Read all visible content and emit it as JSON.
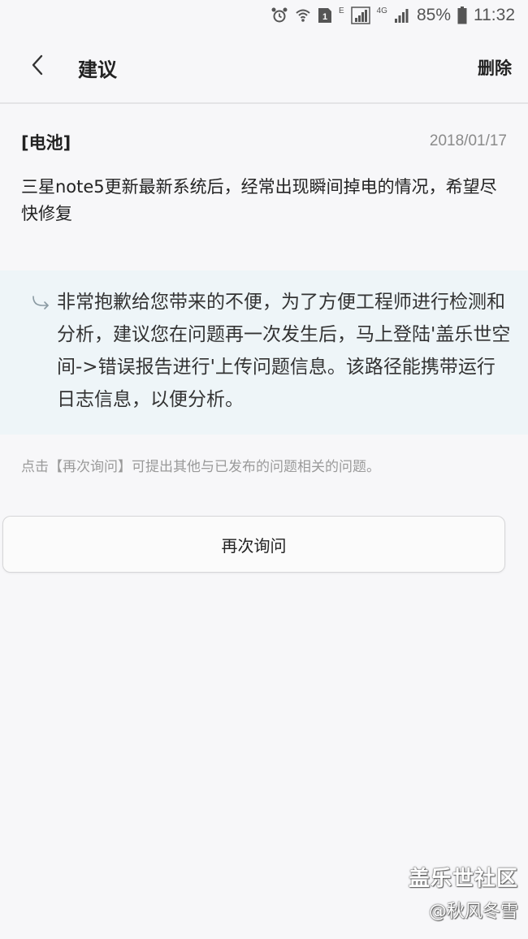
{
  "status_bar": {
    "signal_e": "E",
    "network_4g": "4G",
    "battery_percent": "85%",
    "time": "11:32",
    "icons": [
      "alarm-icon",
      "wifi-icon",
      "sim-icon",
      "signal-icon",
      "battery-icon"
    ]
  },
  "header": {
    "title": "建议",
    "delete_label": "删除",
    "back_icon": "chevron-left-icon"
  },
  "question": {
    "category": "[电池]",
    "date": "2018/01/17",
    "text": "三星note5更新最新系统后，经常出现瞬间掉电的情况，希望尽快修复"
  },
  "answer": {
    "icon": "reply-arrow-icon",
    "text": "非常抱歉给您带来的不便，为了方便工程师进行检测和分析，建议您在问题再一次发生后，马上登陆'盖乐世空间->错误报告进行'上传问题信息。该路径能携带运行日志信息，以便分析。"
  },
  "hint": "点击【再次询问】可提出其他与已发布的问题相关的问题。",
  "ask_again_label": "再次询问",
  "watermark": {
    "line1": "盖乐世社区",
    "line2": "@秋风冬雪"
  },
  "colors": {
    "background": "#f7f7f9",
    "answer_panel": "#eef5f8",
    "muted_text": "#9a9a9a"
  }
}
